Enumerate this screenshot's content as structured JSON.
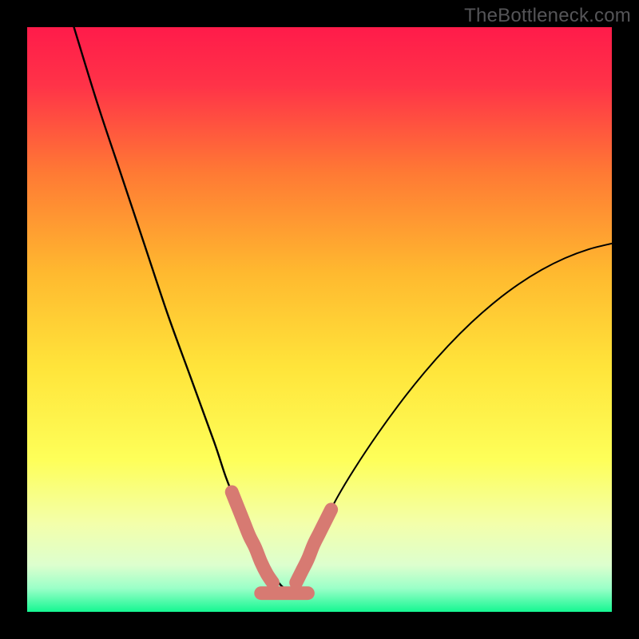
{
  "watermark": "TheBottleneck.com",
  "chart_data": {
    "type": "line",
    "title": "",
    "xlabel": "",
    "ylabel": "",
    "xlim": [
      0,
      100
    ],
    "ylim": [
      0,
      100
    ],
    "background_gradient": {
      "top": "#ff1b4a",
      "upper_mid": "#ff9a2b",
      "mid": "#ffe83a",
      "lower_mid": "#f7ffb0",
      "bottom": "#15f792"
    },
    "series": [
      {
        "name": "left-arm",
        "description": "Steep curve descending from upper-left to valley floor",
        "x": [
          8,
          12,
          16,
          20,
          24,
          28,
          32,
          34,
          36,
          37.5,
          39,
          40.5,
          42,
          43,
          44,
          45
        ],
        "y": [
          100,
          87,
          75,
          63,
          51,
          40,
          29,
          23,
          18,
          14,
          11,
          8.5,
          6.5,
          5,
          4,
          3.5
        ]
      },
      {
        "name": "right-arm",
        "description": "Curve rising from valley floor up toward right edge",
        "x": [
          45,
          46,
          47.5,
          49,
          51,
          53,
          56,
          60,
          64,
          68,
          72,
          76,
          80,
          84,
          88,
          92,
          96,
          100
        ],
        "y": [
          3.5,
          5,
          8,
          11.5,
          15.5,
          19.5,
          24.5,
          30.5,
          36,
          41,
          45.5,
          49.5,
          53,
          56,
          58.5,
          60.5,
          62,
          63
        ]
      },
      {
        "name": "highlight-left",
        "description": "Salmon thick highlight on lower-left arm",
        "x": [
          35,
          36,
          37,
          38,
          39,
          40,
          41,
          42
        ],
        "y": [
          20.5,
          18,
          15.5,
          13,
          11,
          8.5,
          6.5,
          5
        ]
      },
      {
        "name": "highlight-right",
        "description": "Salmon thick highlight on lower-right arm",
        "x": [
          46,
          47,
          48,
          49,
          50,
          51,
          52
        ],
        "y": [
          5,
          7,
          9,
          11.5,
          13.5,
          15.5,
          17.5
        ]
      },
      {
        "name": "valley-floor",
        "description": "Salmon thick highlight across valley bottom",
        "x": [
          40,
          41,
          42,
          43,
          44,
          45,
          46,
          47,
          48
        ],
        "y": [
          3.2,
          3.2,
          3.2,
          3.2,
          3.2,
          3.2,
          3.2,
          3.2,
          3.2
        ]
      }
    ],
    "colors": {
      "curve": "#000000",
      "highlight": "#d77a72"
    }
  }
}
